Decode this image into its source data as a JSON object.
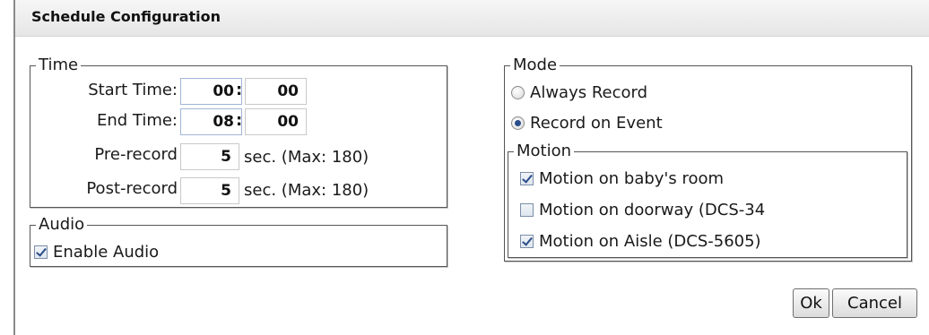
{
  "header": {
    "title": "Schedule Configuration"
  },
  "time": {
    "legend": "Time",
    "start_label": "Start Time:",
    "start_hour": "00",
    "start_min": "00",
    "end_label": "End Time:",
    "end_hour": "08",
    "end_min": "00",
    "colon": ":",
    "pre_label": "Pre-record",
    "pre_value": "5",
    "pre_unit": "sec. (Max: 180)",
    "post_label": "Post-record",
    "post_value": "5",
    "post_unit": "sec. (Max: 180)"
  },
  "audio": {
    "legend": "Audio",
    "enable_label": "Enable Audio",
    "enable_checked": true
  },
  "mode": {
    "legend": "Mode",
    "always_label": "Always Record",
    "event_label": "Record on Event",
    "selected": "event"
  },
  "motion": {
    "legend": "Motion",
    "items": [
      {
        "label": "Motion on baby's room",
        "checked": true
      },
      {
        "label": "Motion on doorway (DCS-34",
        "checked": false
      },
      {
        "label": "Motion on Aisle (DCS-5605)",
        "checked": true
      }
    ]
  },
  "buttons": {
    "ok": "Ok",
    "cancel": "Cancel"
  }
}
